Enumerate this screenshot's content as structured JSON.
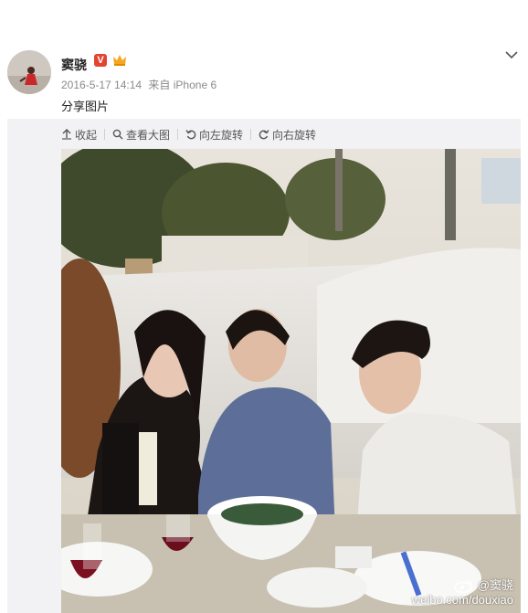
{
  "post": {
    "username": "窦骁",
    "verified_badge": "V",
    "timestamp": "2016-5-17 14:14",
    "source": "来自 iPhone 6",
    "text": "分享图片"
  },
  "toolbar": {
    "collapse_label": "收起",
    "view_large_label": "查看大图",
    "rotate_left_label": "向左旋转",
    "rotate_right_label": "向右旋转"
  },
  "watermark": {
    "handle": "@窦骁",
    "url": "weibo.com/douxiao"
  },
  "icons": {
    "collapse": "arrow-up-icon",
    "view_large": "search-icon",
    "rotate_left": "rotate-left-icon",
    "rotate_right": "rotate-right-icon",
    "menu": "chevron-down-icon"
  },
  "colors": {
    "badge_red": "#e2452f",
    "panel_bg": "#f2f2f5",
    "meta_gray": "#8a8a8a"
  }
}
